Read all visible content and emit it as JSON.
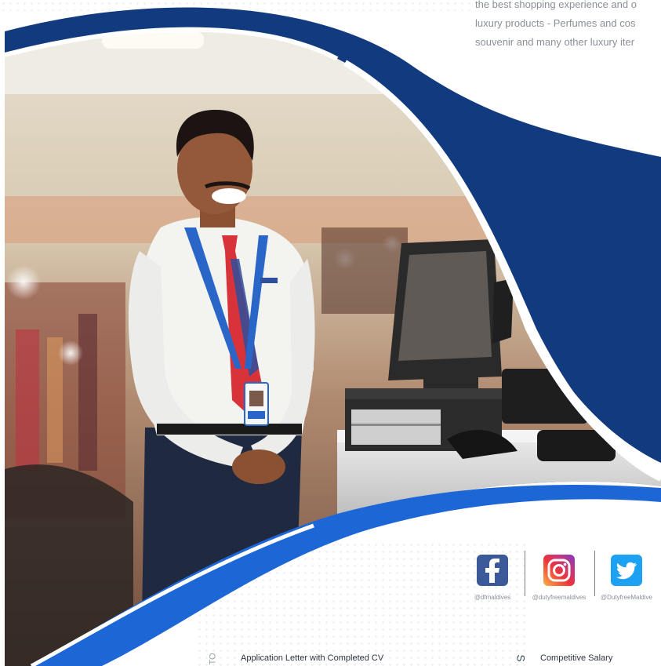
{
  "intro_lines": [
    "the best shopping experience and o",
    "luxury products - Perfumes and cos",
    "souvenir and many other luxury iter"
  ],
  "social": [
    {
      "network": "facebook",
      "icon": "facebook-icon",
      "handle": "@dfmaldives",
      "color": "#3b5998"
    },
    {
      "network": "instagram",
      "icon": "instagram-icon",
      "handle": "@dutyfreemaldives",
      "color": "#d6249f"
    },
    {
      "network": "twitter",
      "icon": "twitter-icon",
      "handle": "@DutyfreeMaldive",
      "color": "#1da1f2"
    }
  ],
  "requirements_item": "Application Letter with Completed CV",
  "benefits_item": "Competitive Salary",
  "colors": {
    "navy": "#123a7e",
    "royal_blue": "#1d66d6",
    "shirt": "#f3f3f0",
    "tie_red": "#d8333a",
    "lanyard": "#2a66c8"
  }
}
